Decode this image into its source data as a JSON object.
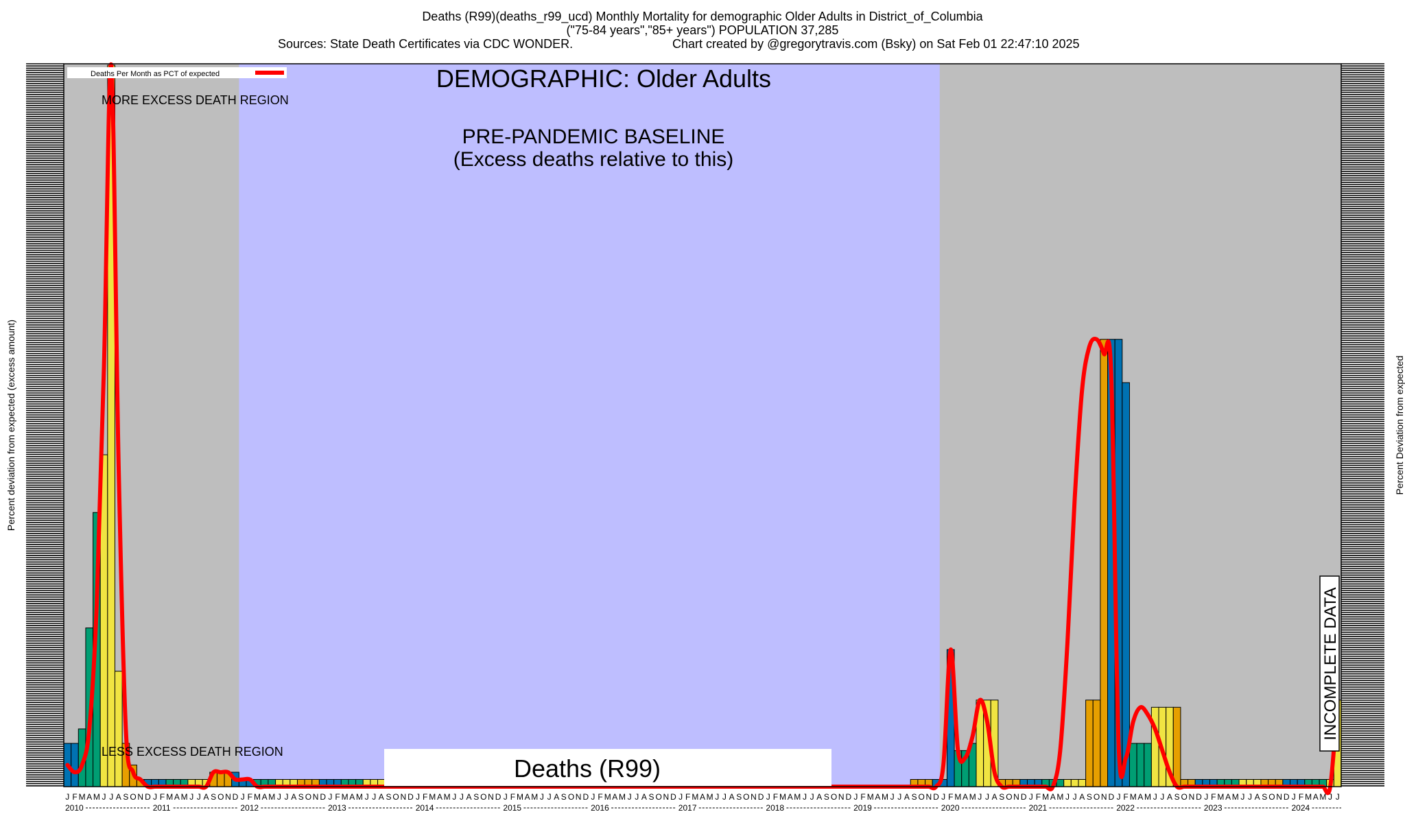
{
  "chart_data": {
    "type": "bar",
    "title_line1": "Deaths (R99)(deaths_r99_ucd) Monthly Mortality for demographic Older Adults in District_of_Columbia",
    "title_line2": "(\"75-84 years\",\"85+ years\") POPULATION 37,285",
    "title_line3_left": "Sources: State Death Certificates via CDC WONDER.",
    "title_line3_right": "Chart created by @gregorytravis.com (Bsky) on Sat Feb 01 22:47:10 2025",
    "ylabel_left": "Percent deviation from expected (excess amount)",
    "ylabel_right": "Percent Deviation from expected",
    "legend_label": "Deaths Per Month as PCT of expected",
    "annotations": {
      "demographic": "DEMOGRAPHIC: Older Adults",
      "baseline_line1": "PRE-PANDEMIC BASELINE",
      "baseline_line2": "(Excess deaths relative to this)",
      "more_excess": "MORE EXCESS DEATH REGION",
      "less_excess": "LESS EXCESS DEATH REGION",
      "incomplete": "INCOMPLETE DATA",
      "bottom_label": "Deaths (R99)"
    },
    "month_letters": [
      "J",
      "F",
      "M",
      "A",
      "M",
      "J",
      "J",
      "A",
      "S",
      "O",
      "N",
      "D"
    ],
    "years": [
      "2010",
      "2011",
      "2012",
      "2013",
      "2014",
      "2015",
      "2016",
      "2017",
      "2018",
      "2019",
      "2020",
      "2021",
      "2022",
      "2023",
      "2024"
    ],
    "start_year": 2010,
    "last_year_months": 7,
    "baseline_region": {
      "start": "2012-01",
      "end": "2019-12"
    },
    "ylim": [
      0,
      100
    ],
    "grid": false,
    "legend_position": "top-left",
    "season_colors": [
      "#0072b2",
      "#009e73",
      "#f0e442",
      "#e69f00"
    ],
    "colors": {
      "plot_bg": "#bebebe",
      "baseline_bg": "#bebeff",
      "line": "#ff0000"
    },
    "values": [
      6,
      6,
      8,
      22,
      38,
      46,
      100,
      16,
      6,
      3,
      1,
      1,
      1,
      1,
      1,
      1,
      1,
      1,
      1,
      1,
      2,
      2,
      2,
      2,
      1,
      1,
      1,
      1,
      1,
      1,
      1,
      1,
      1,
      1,
      1,
      1,
      1,
      1,
      1,
      1,
      1,
      1,
      1,
      1,
      1,
      1,
      1,
      1,
      0,
      0,
      0,
      0,
      0,
      0,
      0,
      0,
      0,
      0,
      0,
      0,
      0,
      0,
      0,
      0,
      0,
      0,
      0,
      0,
      0,
      0,
      0,
      0,
      0,
      0,
      0,
      0,
      0,
      0,
      0,
      0,
      0,
      0,
      0,
      0,
      0,
      0,
      0,
      0,
      0,
      0,
      0,
      0,
      0,
      0,
      0,
      0,
      0,
      0,
      0,
      0,
      0,
      0,
      0,
      0,
      0,
      0,
      0,
      0,
      0,
      0,
      0,
      0,
      0,
      0,
      0,
      0,
      1,
      1,
      1,
      1,
      1,
      19,
      5,
      5,
      6,
      12,
      12,
      12,
      1,
      1,
      1,
      1,
      1,
      1,
      1,
      1,
      1,
      1,
      1,
      1,
      12,
      12,
      62,
      62,
      62,
      56,
      6,
      6,
      6,
      11,
      11,
      11,
      11,
      1,
      1,
      1,
      1,
      1,
      1,
      1,
      1,
      1,
      1,
      1,
      1,
      1,
      1,
      1,
      1,
      1,
      1,
      1,
      1,
      1,
      12
    ],
    "line_values": [
      3,
      2,
      3,
      8,
      25,
      58,
      100,
      45,
      8,
      2,
      1,
      0,
      0,
      0,
      0,
      0,
      0,
      0,
      0,
      0,
      2,
      2,
      2,
      1,
      1,
      1,
      0,
      0,
      0,
      0,
      0,
      0,
      0,
      0,
      0,
      0,
      0,
      0,
      0,
      0,
      0,
      0,
      0,
      0,
      0,
      0,
      0,
      0,
      0,
      0,
      0,
      0,
      0,
      0,
      0,
      0,
      0,
      0,
      0,
      0,
      0,
      0,
      0,
      0,
      0,
      0,
      0,
      0,
      0,
      0,
      0,
      0,
      0,
      0,
      0,
      0,
      0,
      0,
      0,
      0,
      0,
      0,
      0,
      0,
      0,
      0,
      0,
      0,
      0,
      0,
      0,
      0,
      0,
      0,
      0,
      0,
      0,
      0,
      0,
      0,
      0,
      0,
      0,
      0,
      0,
      0,
      0,
      0,
      0,
      0,
      0,
      0,
      0,
      0,
      0,
      0,
      0,
      0,
      0,
      0,
      3,
      19,
      5,
      4,
      7,
      12,
      9,
      2,
      0,
      0,
      0,
      0,
      0,
      0,
      0,
      0,
      5,
      20,
      40,
      55,
      61,
      62,
      60,
      57,
      6,
      4,
      9,
      11,
      10,
      8,
      5,
      2,
      0,
      0,
      0,
      0,
      0,
      0,
      0,
      0,
      0,
      0,
      0,
      0,
      0,
      0,
      0,
      0,
      0,
      0,
      0,
      0,
      0,
      0,
      12
    ]
  }
}
